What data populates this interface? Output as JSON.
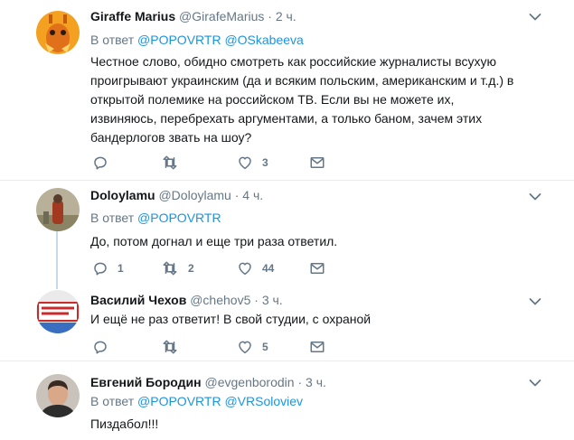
{
  "tweets": [
    {
      "name": "Giraffe Marius",
      "handle": "@GirafeMarius",
      "time": "2 ч.",
      "reply_prefix": "В ответ",
      "mentions": [
        "@POPOVRTR",
        "@OSkabeeva"
      ],
      "text": "Честное слово, обидно смотреть как российские журналисты всухую проигрывают украинским (да и всяким польским, американским и т.д.) в открытой полемике на российском ТВ. Если вы не можете их, извиняюсь, перебрехать аргументами, а только баном, зачем этих бандерлогов звать на шоу?",
      "replies": "",
      "retweets": "",
      "likes": "3"
    },
    {
      "name": "Doloylamu",
      "handle": "@Doloylamu",
      "time": "4 ч.",
      "reply_prefix": "В ответ",
      "mentions": [
        "@POPOVRTR"
      ],
      "text": "До, потом догнал и еще три раза ответил.",
      "replies": "1",
      "retweets": "2",
      "likes": "44"
    },
    {
      "name": "Василий Чехов",
      "handle": "@chehov5",
      "time": "3 ч.",
      "text": "И ещё не раз ответит! В свой студии, с охраной",
      "replies": "",
      "retweets": "",
      "likes": "5"
    },
    {
      "name": "Евгений Бородин",
      "handle": "@evgenborodin",
      "time": "3 ч.",
      "reply_prefix": "В ответ",
      "mentions": [
        "@POPOVRTR",
        "@VRSoloviev"
      ],
      "text": "Пиздабол!!!"
    }
  ],
  "sep": "·",
  "icons": {
    "reply": "reply-icon",
    "retweet": "retweet-icon",
    "like": "heart-icon",
    "dm": "envelope-icon",
    "more": "chevron-down-icon"
  },
  "colors": {
    "accent": "#1b95e0",
    "muted": "#657786",
    "text": "#14171a"
  }
}
